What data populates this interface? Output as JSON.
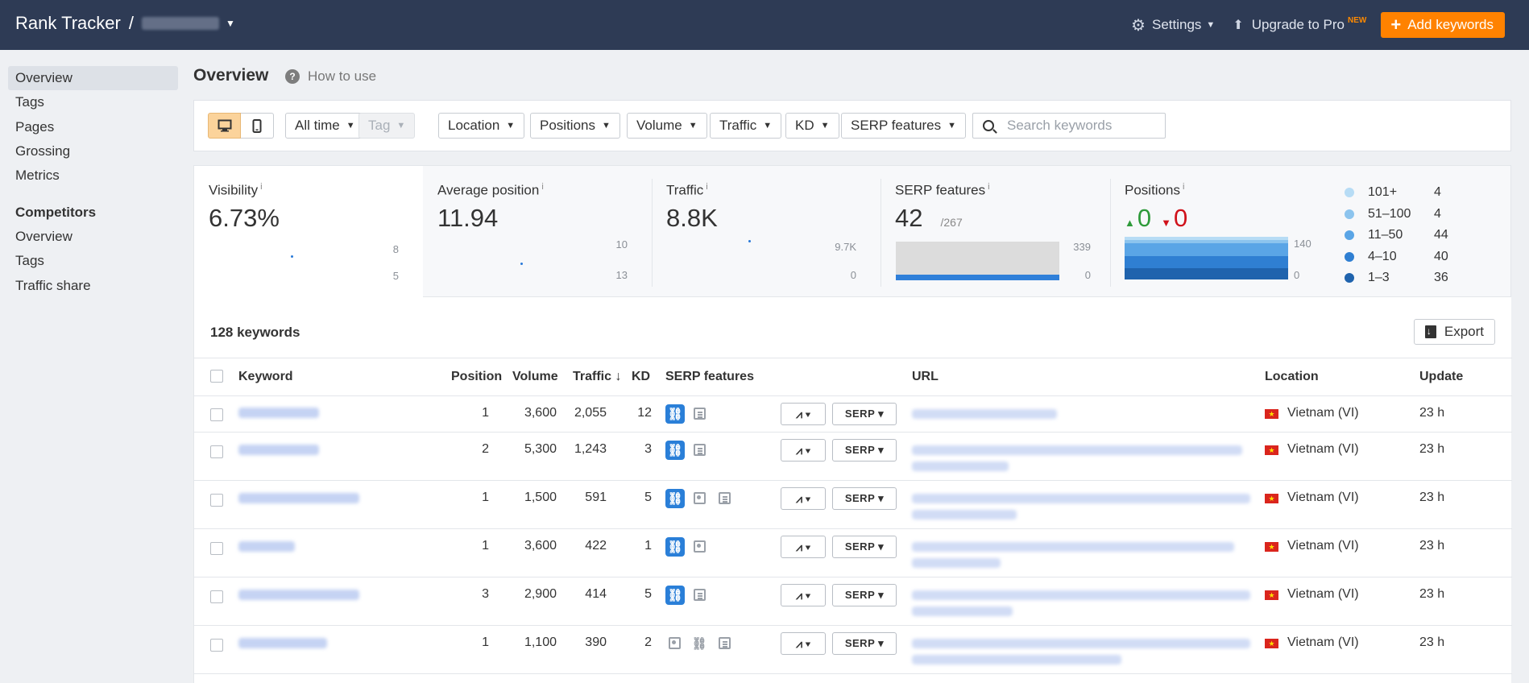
{
  "header": {
    "brand": "Rank Tracker",
    "separator": "/",
    "settings_label": "Settings",
    "upgrade_label": "Upgrade to Pro",
    "upgrade_badge": "NEW",
    "add_keywords_label": "Add keywords"
  },
  "sidebar": {
    "items": [
      {
        "label": "Overview",
        "active": true
      },
      {
        "label": "Tags"
      },
      {
        "label": "Pages"
      },
      {
        "label": "Grossing"
      },
      {
        "label": "Metrics"
      }
    ],
    "competitors_heading": "Competitors",
    "competitor_items": [
      {
        "label": "Overview"
      },
      {
        "label": "Tags"
      },
      {
        "label": "Traffic share"
      }
    ]
  },
  "page": {
    "title": "Overview",
    "how_to_use": "How to use"
  },
  "filters": {
    "time": "All time",
    "tag": "Tag",
    "location": "Location",
    "positions": "Positions",
    "volume": "Volume",
    "traffic": "Traffic",
    "kd": "KD",
    "serp_features": "SERP features",
    "search_placeholder": "Search keywords"
  },
  "metrics": {
    "visibility": {
      "label": "Visibility",
      "info": "i",
      "value": "6.73%",
      "axis_top": "8",
      "axis_bottom": "5"
    },
    "avg_position": {
      "label": "Average position",
      "info": "i",
      "value": "11.94",
      "axis_top": "10",
      "axis_bottom": "13"
    },
    "traffic": {
      "label": "Traffic",
      "info": "i",
      "value": "8.8K",
      "axis_top": "9.7K",
      "axis_bottom": "0"
    },
    "serp_features": {
      "label": "SERP features",
      "info": "i",
      "value": "42",
      "sub": "/267",
      "axis_top": "339",
      "axis_bottom": "0"
    },
    "positions": {
      "label": "Positions",
      "info": "i",
      "up": "0",
      "down": "0",
      "axis_top": "140",
      "axis_bottom": "0",
      "legend": [
        {
          "label": "101+",
          "value": "4",
          "color": "#b7dcf5"
        },
        {
          "label": "51–100",
          "value": "4",
          "color": "#8cc4ee"
        },
        {
          "label": "11–50",
          "value": "44",
          "color": "#5aa5e6"
        },
        {
          "label": "4–10",
          "value": "40",
          "color": "#2f7fd2"
        },
        {
          "label": "1–3",
          "value": "36",
          "color": "#1f63ad"
        }
      ]
    }
  },
  "table": {
    "count_label": "128 keywords",
    "export_label": "Export",
    "columns": {
      "keyword": "Keyword",
      "position": "Position",
      "volume": "Volume",
      "traffic": "Traffic ↓",
      "kd": "KD",
      "serp_features": "SERP features",
      "url": "URL",
      "location": "Location",
      "update": "Update"
    },
    "serp_button": "SERP ▾",
    "chart_button": "⩘ ▾",
    "rows": [
      {
        "position": "1",
        "volume": "3,600",
        "traffic": "2,055",
        "kd": "12",
        "location": "Vietnam (VI)",
        "update": "23 h"
      },
      {
        "position": "2",
        "volume": "5,300",
        "traffic": "1,243",
        "kd": "3",
        "location": "Vietnam (VI)",
        "update": "23 h"
      },
      {
        "position": "1",
        "volume": "1,500",
        "traffic": "591",
        "kd": "5",
        "location": "Vietnam (VI)",
        "update": "23 h"
      },
      {
        "position": "1",
        "volume": "3,600",
        "traffic": "422",
        "kd": "1",
        "location": "Vietnam (VI)",
        "update": "23 h"
      },
      {
        "position": "3",
        "volume": "2,900",
        "traffic": "414",
        "kd": "5",
        "location": "Vietnam (VI)",
        "update": "23 h"
      },
      {
        "position": "1",
        "volume": "1,100",
        "traffic": "390",
        "kd": "2",
        "location": "Vietnam (VI)",
        "update": "23 h"
      }
    ]
  }
}
